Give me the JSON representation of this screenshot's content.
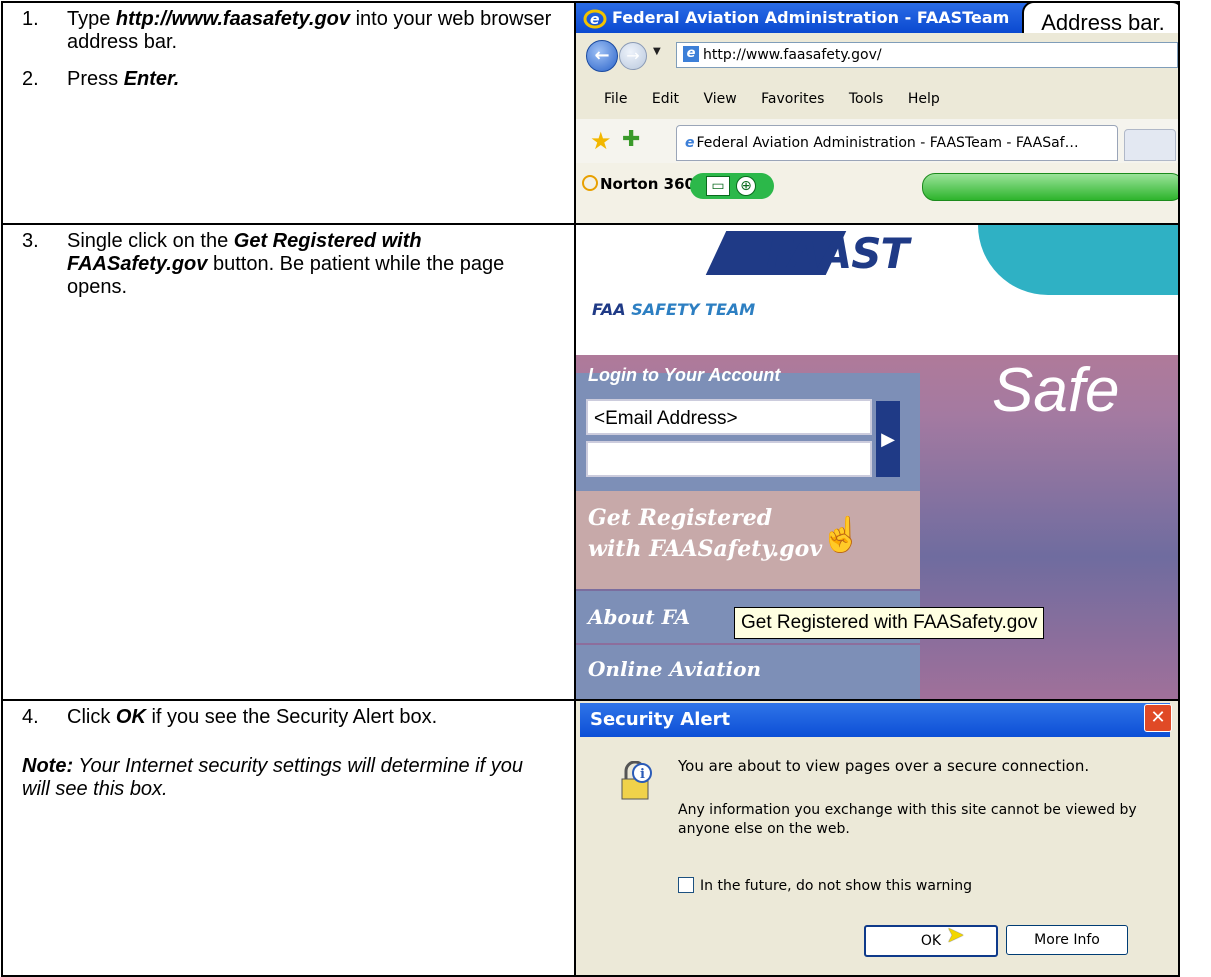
{
  "steps": {
    "s1": {
      "num": "1.",
      "pre": "Type ",
      "url": "http://www.faasafety.gov",
      "post": " into your web browser address bar."
    },
    "s2": {
      "num": "2.",
      "pre": "Press ",
      "key": "Enter."
    },
    "s3": {
      "num": "3.",
      "pre": "Single click on the ",
      "button": "Get Registered with FAASafety.gov",
      "post": " button.  Be patient while the page opens."
    },
    "s4": {
      "num": "4.",
      "pre": "Click ",
      "ok": "OK",
      "post": " if you see the Security Alert box."
    },
    "note": {
      "label": "Note:",
      "text": "  Your Internet security settings will determine if you will see this box."
    }
  },
  "browser": {
    "title": "Federal Aviation Administration - FAASTeam",
    "callout": "Address bar.",
    "address": "http://www.faasafety.gov/",
    "menu": [
      "File",
      "Edit",
      "View",
      "Favorites",
      "Tools",
      "Help"
    ],
    "tab_title": "Federal Aviation Administration - FAASTeam - FAASaf…",
    "norton": "Norton 360"
  },
  "faast": {
    "logo": "FAAST",
    "subtitle_a": "FAA ",
    "subtitle_b": "SAFETY TEAM",
    "login_title": "Login to Your Account",
    "email_placeholder": "<Email Address>",
    "register_line1": "Get Registered",
    "register_line2": "with FAASafety.gov",
    "about": "About FA",
    "online": "Online Aviation",
    "tooltip": "Get Registered with FAASafety.gov",
    "hero": "Safe"
  },
  "alert": {
    "title": "Security Alert",
    "msg1": "You are about to view pages over a secure connection.",
    "msg2": "Any information you exchange with this site cannot be viewed by anyone else on the web.",
    "checkbox": "In the future, do not show this warning",
    "checked": false,
    "ok": "OK",
    "more": "More Info"
  }
}
